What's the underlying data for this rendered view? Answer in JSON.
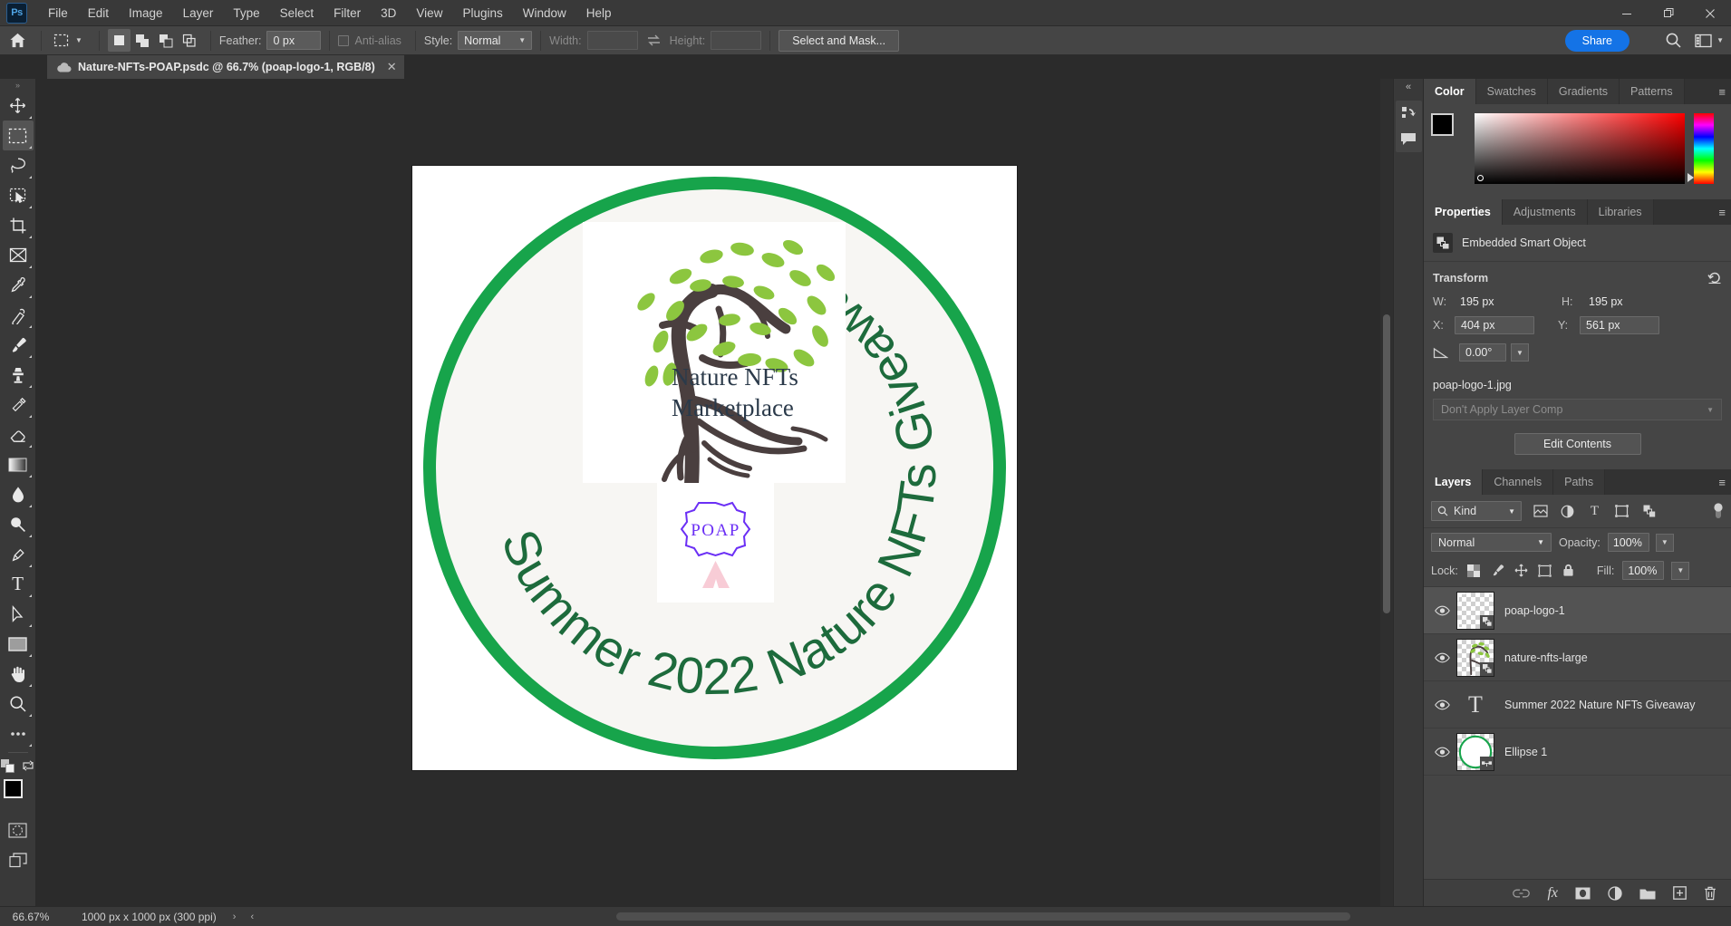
{
  "app": {
    "name": "Adobe Photoshop",
    "logo_text": "Ps"
  },
  "menubar": {
    "items": [
      "File",
      "Edit",
      "Image",
      "Layer",
      "Type",
      "Select",
      "Filter",
      "3D",
      "View",
      "Plugins",
      "Window",
      "Help"
    ]
  },
  "window_controls": {
    "minimize": "—",
    "maximize": "❐",
    "close": "✕"
  },
  "options_bar": {
    "home_icon": "home-icon",
    "tool_preset_icon": "marquee-tool-icon",
    "selection_modes": [
      "new-selection",
      "add-to-selection",
      "subtract-from-selection",
      "intersect-with-selection"
    ],
    "feather_label": "Feather:",
    "feather_value": "0 px",
    "antialias_label": "Anti-alias",
    "antialias_checked": false,
    "style_label": "Style:",
    "style_value": "Normal",
    "width_label": "Width:",
    "width_value": "",
    "swap_icon": "swap-width-height-icon",
    "height_label": "Height:",
    "height_value": "",
    "select_and_mask": "Select and Mask...",
    "share": "Share",
    "search_icon": "search-icon",
    "workspace_icon": "workspace-switcher-icon"
  },
  "document_tab": {
    "icon": "cloud-document-icon",
    "title": "Nature-NFTs-POAP.psdc @ 66.7% (poap-logo-1, RGB/8)",
    "close": "✕"
  },
  "toolbar": {
    "tools": [
      {
        "name": "move-tool",
        "active": false
      },
      {
        "name": "rectangular-marquee-tool",
        "active": true
      },
      {
        "name": "lasso-tool",
        "active": false
      },
      {
        "name": "object-selection-tool",
        "active": false
      },
      {
        "name": "crop-tool",
        "active": false
      },
      {
        "name": "frame-tool",
        "active": false
      },
      {
        "name": "eyedropper-tool",
        "active": false
      },
      {
        "name": "spot-healing-brush-tool",
        "active": false
      },
      {
        "name": "brush-tool",
        "active": false
      },
      {
        "name": "clone-stamp-tool",
        "active": false
      },
      {
        "name": "history-brush-tool",
        "active": false
      },
      {
        "name": "eraser-tool",
        "active": false
      },
      {
        "name": "gradient-tool",
        "active": false
      },
      {
        "name": "blur-tool",
        "active": false
      },
      {
        "name": "dodge-tool",
        "active": false
      },
      {
        "name": "pen-tool",
        "active": false
      },
      {
        "name": "horizontal-type-tool",
        "active": false
      },
      {
        "name": "path-selection-tool",
        "active": false
      },
      {
        "name": "rectangle-tool",
        "active": false
      },
      {
        "name": "hand-tool",
        "active": false
      },
      {
        "name": "zoom-tool",
        "active": false
      },
      {
        "name": "edit-toolbar-tool",
        "active": false
      }
    ],
    "default_colors_icon": "default-foreground-background-icon",
    "swap_colors_icon": "swap-foreground-background-icon",
    "foreground_color": "#000000",
    "background_color": "#ffffff",
    "quick_mask_icon": "quick-mask-mode-icon",
    "screen_mode_icon": "screen-mode-icon"
  },
  "canvas": {
    "artwork": {
      "ring_color": "#17a44b",
      "badge_bg": "#f7f6f3",
      "curved_text_left": "Summer 2022 Nature NFTs Giveaway",
      "curved_text_color": "#1d6b3c",
      "logo_title_line1": "Nature NFTs",
      "logo_title_line2": "Marketplace",
      "logo_title_color": "#2b3a4a",
      "tree_trunk_color": "#4a3f3f",
      "leaf_color": "#8cc63f",
      "poap_label": "POAP",
      "poap_color": "#6b2ff5",
      "poap_ribbon_color": "#f8ccd6"
    }
  },
  "mini_dock": {
    "collapse_icon": "collapse-panels-icon",
    "items": [
      "libraries-icon",
      "comments-icon"
    ]
  },
  "color_panel": {
    "tabs": [
      {
        "label": "Color",
        "active": true
      },
      {
        "label": "Swatches",
        "active": false
      },
      {
        "label": "Gradients",
        "active": false
      },
      {
        "label": "Patterns",
        "active": false
      }
    ],
    "menu_icon": "panel-menu-icon",
    "foreground_color": "#000000",
    "background_color": "#ffffff",
    "selected_hue": "#ff0000"
  },
  "properties_panel": {
    "tabs": [
      {
        "label": "Properties",
        "active": true
      },
      {
        "label": "Adjustments",
        "active": false
      },
      {
        "label": "Libraries",
        "active": false
      }
    ],
    "menu_icon": "panel-menu-icon",
    "object_type_icon": "embedded-smart-object-icon",
    "object_type": "Embedded Smart Object",
    "transform_title": "Transform",
    "reset_icon": "reset-transform-icon",
    "w_label": "W:",
    "w_value": "195 px",
    "h_label": "H:",
    "h_value": "195 px",
    "x_label": "X:",
    "x_value": "404 px",
    "y_label": "Y:",
    "y_value": "561 px",
    "angle_icon": "rotation-angle-icon",
    "angle_value": "0.00°",
    "file_name": "poap-logo-1.jpg",
    "layer_comp_placeholder": "Don't Apply Layer Comp",
    "edit_contents_label": "Edit Contents"
  },
  "layers_panel": {
    "tabs": [
      {
        "label": "Layers",
        "active": true
      },
      {
        "label": "Channels",
        "active": false
      },
      {
        "label": "Paths",
        "active": false
      }
    ],
    "menu_icon": "panel-menu-icon",
    "filter_kind_label": "Kind",
    "filter_icons": [
      "filter-pixel-icon",
      "filter-adjustment-icon",
      "filter-type-icon",
      "filter-shape-icon",
      "filter-smart-object-icon"
    ],
    "filter_toggle_icon": "filter-enable-toggle",
    "blend_mode": "Normal",
    "opacity_label": "Opacity:",
    "opacity_value": "100%",
    "lock_label": "Lock:",
    "lock_icons": [
      "lock-transparent-pixels-icon",
      "lock-image-pixels-icon",
      "lock-position-icon",
      "lock-artboard-nesting-icon",
      "lock-all-icon"
    ],
    "fill_label": "Fill:",
    "fill_value": "100%",
    "layers": [
      {
        "name": "poap-logo-1",
        "type": "smart-object",
        "visible": true,
        "selected": true
      },
      {
        "name": "nature-nfts-large",
        "type": "smart-object",
        "visible": true,
        "selected": false
      },
      {
        "name": "Summer 2022 Nature NFTs Giveaway",
        "type": "text",
        "visible": true,
        "selected": false
      },
      {
        "name": "Ellipse 1",
        "type": "shape",
        "visible": true,
        "selected": false
      }
    ],
    "bottom_icons": [
      "link-layers-icon",
      "layer-style-fx-icon",
      "add-layer-mask-icon",
      "new-fill-adjustment-layer-icon",
      "new-group-icon",
      "new-layer-icon",
      "delete-layer-icon"
    ],
    "fx_label": "fx"
  },
  "status_bar": {
    "zoom": "66.67%",
    "doc_size": "1000 px x 1000 px (300 ppi)",
    "arrow_right": "›",
    "arrow_left": "‹"
  }
}
